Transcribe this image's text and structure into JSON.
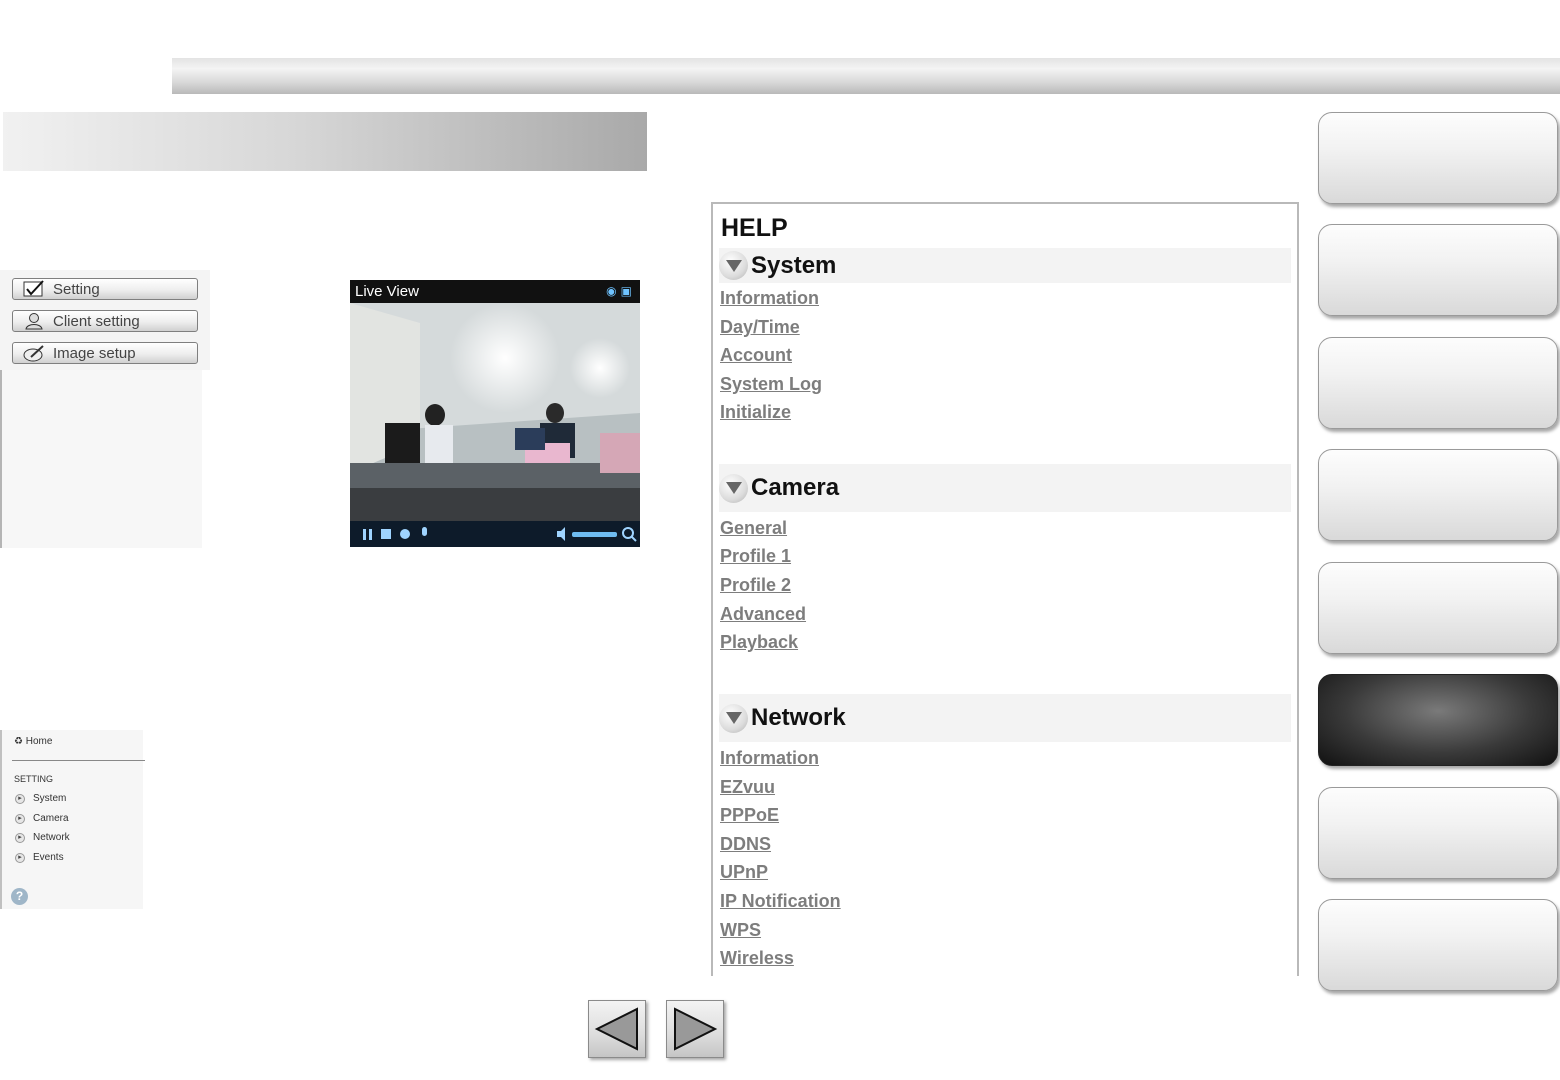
{
  "menu": {
    "buttons": [
      {
        "label": "Setting",
        "icon": "checkmark-icon"
      },
      {
        "label": "Client setting",
        "icon": "user-icon"
      },
      {
        "label": "Image setup",
        "icon": "image-setup-icon"
      }
    ]
  },
  "live_view": {
    "title": "Live View",
    "icons": [
      "camera-snapshot-icon",
      "fullscreen-icon"
    ],
    "controls": [
      "pause-icon",
      "stop-icon",
      "record-icon",
      "microphone-icon",
      "speaker-icon",
      "volume-slider",
      "zoom-icon"
    ]
  },
  "nav_panel": {
    "home": "Home",
    "section": "SETTING",
    "items": [
      "System",
      "Camera",
      "Network",
      "Events"
    ],
    "help_icon": "help-icon"
  },
  "help": {
    "title": "HELP",
    "sections": [
      {
        "name": "System",
        "links": [
          "Information",
          "Day/Time",
          "Account",
          "System Log",
          "Initialize"
        ]
      },
      {
        "name": "Camera",
        "links": [
          "General",
          "Profile 1",
          "Profile 2",
          "Advanced",
          "Playback"
        ]
      },
      {
        "name": "Network",
        "links": [
          "Information",
          "EZvuu",
          "PPPoE",
          "DDNS",
          "UPnP",
          "IP Notification",
          "WPS",
          "Wireless"
        ]
      }
    ]
  },
  "tabs": {
    "count": 8,
    "active_index": 5
  },
  "pager": {
    "prev_icon": "previous-arrow-icon",
    "next_icon": "next-arrow-icon"
  }
}
